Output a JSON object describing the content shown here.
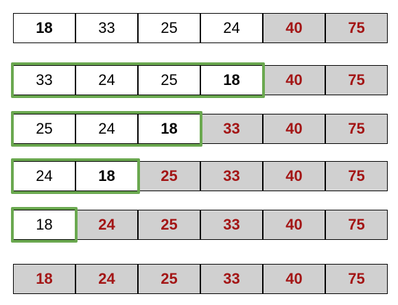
{
  "colors": {
    "sorted_fill": "#d0d0d0",
    "sorted_text": "#a31515",
    "highlight_border": "#6aa84f",
    "cell_border": "#000000"
  },
  "rows": [
    {
      "cells": [
        {
          "value": "18",
          "bold": true,
          "sorted": false
        },
        {
          "value": "33",
          "bold": false,
          "sorted": false
        },
        {
          "value": "25",
          "bold": false,
          "sorted": false
        },
        {
          "value": "24",
          "bold": false,
          "sorted": false
        },
        {
          "value": "40",
          "bold": true,
          "sorted": true
        },
        {
          "value": "75",
          "bold": true,
          "sorted": true
        }
      ],
      "highlight_count": 0
    },
    {
      "cells": [
        {
          "value": "33",
          "bold": false,
          "sorted": false
        },
        {
          "value": "24",
          "bold": false,
          "sorted": false
        },
        {
          "value": "25",
          "bold": false,
          "sorted": false
        },
        {
          "value": "18",
          "bold": true,
          "sorted": false
        },
        {
          "value": "40",
          "bold": true,
          "sorted": true
        },
        {
          "value": "75",
          "bold": true,
          "sorted": true
        }
      ],
      "highlight_count": 4
    },
    {
      "cells": [
        {
          "value": "25",
          "bold": false,
          "sorted": false
        },
        {
          "value": "24",
          "bold": false,
          "sorted": false
        },
        {
          "value": "18",
          "bold": true,
          "sorted": false
        },
        {
          "value": "33",
          "bold": true,
          "sorted": true
        },
        {
          "value": "40",
          "bold": true,
          "sorted": true
        },
        {
          "value": "75",
          "bold": true,
          "sorted": true
        }
      ],
      "highlight_count": 3
    },
    {
      "cells": [
        {
          "value": "24",
          "bold": false,
          "sorted": false
        },
        {
          "value": "18",
          "bold": true,
          "sorted": false
        },
        {
          "value": "25",
          "bold": true,
          "sorted": true
        },
        {
          "value": "33",
          "bold": true,
          "sorted": true
        },
        {
          "value": "40",
          "bold": true,
          "sorted": true
        },
        {
          "value": "75",
          "bold": true,
          "sorted": true
        }
      ],
      "highlight_count": 2
    },
    {
      "cells": [
        {
          "value": "18",
          "bold": false,
          "sorted": false
        },
        {
          "value": "24",
          "bold": true,
          "sorted": true
        },
        {
          "value": "25",
          "bold": true,
          "sorted": true
        },
        {
          "value": "33",
          "bold": true,
          "sorted": true
        },
        {
          "value": "40",
          "bold": true,
          "sorted": true
        },
        {
          "value": "75",
          "bold": true,
          "sorted": true
        }
      ],
      "highlight_count": 1
    },
    {
      "cells": [
        {
          "value": "18",
          "bold": true,
          "sorted": true
        },
        {
          "value": "24",
          "bold": true,
          "sorted": true
        },
        {
          "value": "25",
          "bold": true,
          "sorted": true
        },
        {
          "value": "33",
          "bold": true,
          "sorted": true
        },
        {
          "value": "40",
          "bold": true,
          "sorted": true
        },
        {
          "value": "75",
          "bold": true,
          "sorted": true
        }
      ],
      "highlight_count": 0
    }
  ]
}
